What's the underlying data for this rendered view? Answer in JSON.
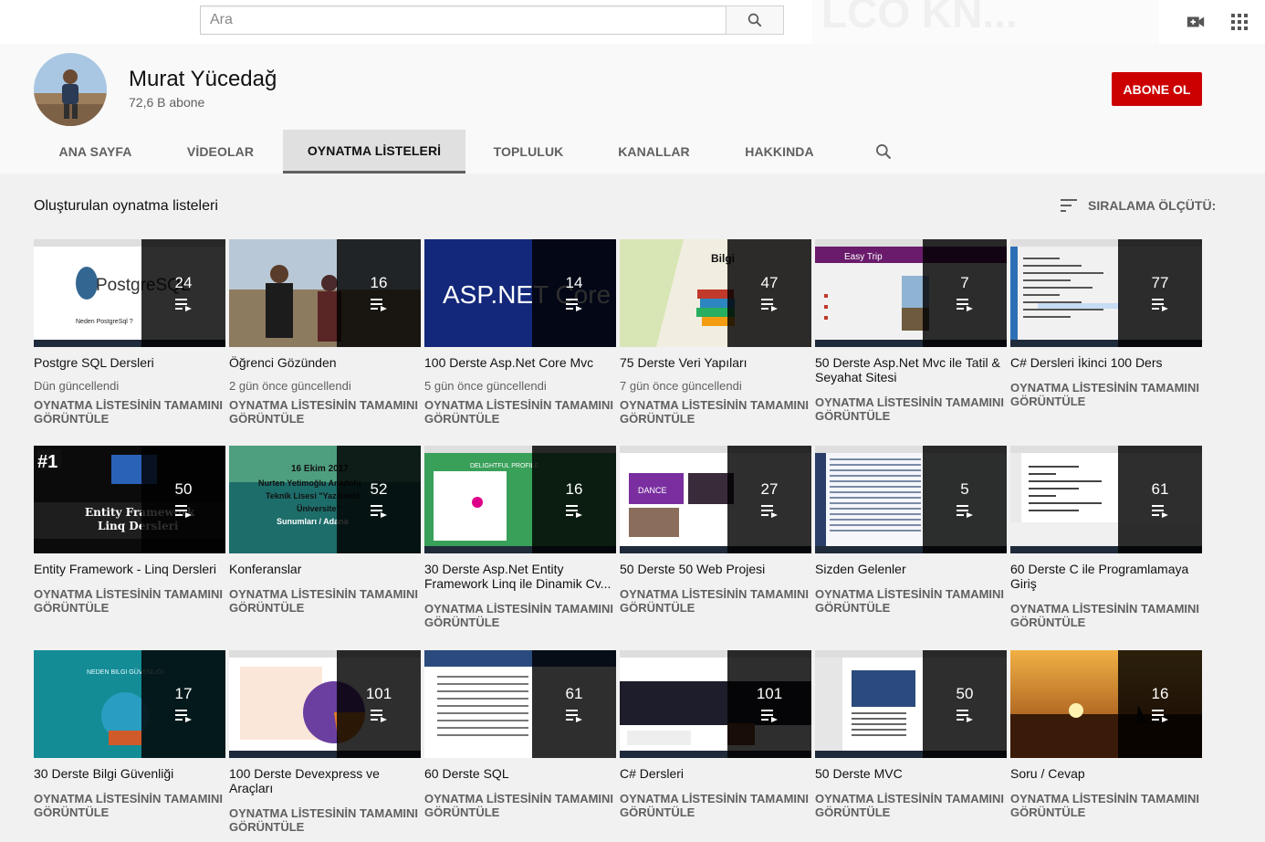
{
  "search": {
    "placeholder": "Ara"
  },
  "channel": {
    "name": "Murat Yücedağ",
    "subscribers": "72,6 B abone",
    "subscribe_label": "ABONE OL"
  },
  "tabs": [
    {
      "label": "ANA SAYFA"
    },
    {
      "label": "VİDEOLAR"
    },
    {
      "label": "OYNATMA LİSTELERİ"
    },
    {
      "label": "TOPLULUK"
    },
    {
      "label": "KANALLAR"
    },
    {
      "label": "HAKKINDA"
    }
  ],
  "active_tab": "OYNATMA LİSTELERİ",
  "section": {
    "title": "Oluşturulan oynatma listeleri",
    "sort_label": "SIRALAMA ÖLÇÜTÜ:"
  },
  "playlists": [
    {
      "title": "Postgre SQL Dersleri",
      "count": "24",
      "updated": "Dün güncellendi",
      "view_all": "OYNATMA LİSTESİNİN TAMAMINI GÖRÜNTÜLE",
      "thumb_color": "#ffffff"
    },
    {
      "title": "Öğrenci Gözünden",
      "count": "16",
      "updated": "2 gün önce güncellendi",
      "view_all": "OYNATMA LİSTESİNİN TAMAMINI GÖRÜNTÜLE",
      "thumb_color": "#8aa3b8"
    },
    {
      "title": "100 Derste Asp.Net Core Mvc",
      "count": "14",
      "updated": "5 gün önce güncellendi",
      "view_all": "OYNATMA LİSTESİNİN TAMAMINI GÖRÜNTÜLE",
      "thumb_color": "#1a2d6b"
    },
    {
      "title": "75 Derste Veri Yapıları",
      "count": "47",
      "updated": "7 gün önce güncellendi",
      "view_all": "OYNATMA LİSTESİNİN TAMAMINI GÖRÜNTÜLE",
      "thumb_color": "#f2efe6"
    },
    {
      "title": "50 Derste Asp.Net Mvc ile Tatil & Seyahat Sitesi",
      "count": "7",
      "updated": "",
      "view_all": "OYNATMA LİSTESİNİN TAMAMINI GÖRÜNTÜLE",
      "thumb_color": "#ffffff"
    },
    {
      "title": "C# Dersleri İkinci 100 Ders",
      "count": "77",
      "updated": "",
      "view_all": "OYNATMA LİSTESİNİN TAMAMINI GÖRÜNTÜLE",
      "thumb_color": "#ffffff"
    },
    {
      "title": "Entity Framework - Linq Dersleri",
      "count": "50",
      "updated": "",
      "view_all": "OYNATMA LİSTESİNİN TAMAMINI GÖRÜNTÜLE",
      "thumb_color": "#111111"
    },
    {
      "title": "Konferanslar",
      "count": "52",
      "updated": "",
      "view_all": "OYNATMA LİSTESİNİN TAMAMINI GÖRÜNTÜLE",
      "thumb_color": "#1f6f6c"
    },
    {
      "title": "30 Derste Asp.Net Entity Framework Linq ile Dinamik Cv...",
      "count": "16",
      "updated": "",
      "view_all": "OYNATMA LİSTESİNİN TAMAMINI GÖRÜNTÜLE",
      "thumb_color": "#3aa45a"
    },
    {
      "title": "50 Derste 50 Web Projesi",
      "count": "27",
      "updated": "",
      "view_all": "OYNATMA LİSTESİNİN TAMAMINI GÖRÜNTÜLE",
      "thumb_color": "#ffffff"
    },
    {
      "title": "Sizden Gelenler",
      "count": "5",
      "updated": "",
      "view_all": "OYNATMA LİSTESİNİN TAMAMINI GÖRÜNTÜLE",
      "thumb_color": "#e8edf5"
    },
    {
      "title": "60 Derste C ile Programlamaya Giriş",
      "count": "61",
      "updated": "",
      "view_all": "OYNATMA LİSTESİNİN TAMAMINI GÖRÜNTÜLE",
      "thumb_color": "#ffffff"
    },
    {
      "title": "30 Derste Bilgi Güvenliği",
      "count": "17",
      "updated": "",
      "view_all": "OYNATMA LİSTESİNİN TAMAMINI GÖRÜNTÜLE",
      "thumb_color": "#1b8a93"
    },
    {
      "title": "100 Derste Devexpress ve Araçları",
      "count": "101",
      "updated": "",
      "view_all": "OYNATMA LİSTESİNİN TAMAMINI GÖRÜNTÜLE",
      "thumb_color": "#ffffff"
    },
    {
      "title": "60 Derste SQL",
      "count": "61",
      "updated": "",
      "view_all": "OYNATMA LİSTESİNİN TAMAMINI GÖRÜNTÜLE",
      "thumb_color": "#ffffff"
    },
    {
      "title": "C# Dersleri",
      "count": "101",
      "updated": "",
      "view_all": "OYNATMA LİSTESİNİN TAMAMINI GÖRÜNTÜLE",
      "thumb_color": "#2a2a2a"
    },
    {
      "title": "50 Derste MVC",
      "count": "50",
      "updated": "",
      "view_all": "OYNATMA LİSTESİNİN TAMAMINI GÖRÜNTÜLE",
      "thumb_color": "#ffffff"
    },
    {
      "title": "Soru / Cevap",
      "count": "16",
      "updated": "",
      "view_all": "OYNATMA LİSTESİNİN TAMAMINI GÖRÜNTÜLE",
      "thumb_color": "#e8902a"
    }
  ],
  "thumb_texts": {
    "postgres": "PostgreSQL",
    "postgres_sub": "Neden PostgreSql ?",
    "aspnet": "ASP.NET Core",
    "bilgi": "Bilgi",
    "easytrip": "Easy Trip",
    "ef_badge": "#1",
    "ef_line1": "Entity Framework",
    "ef_line2": "Linq Dersleri",
    "conf_l1": "16 Ekim 2017",
    "conf_l2": "Nurten Yetimoğlu Anadolu",
    "conf_l3": "Teknik Lisesi \"Yazılımda",
    "conf_l4": "Üniversite\"",
    "conf_l5": "Sunumları / Adana",
    "delightful": "DELIGHTFUL PROFILE",
    "dance": "DANCE",
    "security": "NEDEN BILGI GÜVENLIĞI"
  },
  "icons": [
    "search-icon",
    "create-video-icon",
    "apps-icon",
    "sort-icon",
    "playlist-icon"
  ],
  "colors": {
    "brand_red": "#cc0000",
    "overlay": "rgba(0,0,0,0.82)"
  }
}
